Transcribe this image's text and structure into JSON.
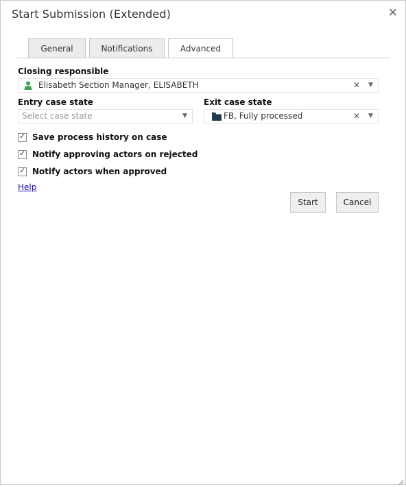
{
  "dialog": {
    "title": "Start Submission (Extended)",
    "close_icon": "close-icon"
  },
  "tabs": [
    {
      "label": "General",
      "active": false
    },
    {
      "label": "Notifications",
      "active": false
    },
    {
      "label": "Advanced",
      "active": true
    }
  ],
  "closing_responsible": {
    "label": "Closing responsible",
    "value": "Elisabeth Section Manager, ELISABETH",
    "icon": "person-icon",
    "icon_color": "#3aa757"
  },
  "entry_case_state": {
    "label": "Entry case state",
    "placeholder": "Select case state"
  },
  "exit_case_state": {
    "label": "Exit case state",
    "value": "FB, Fully processed",
    "icon": "folder-icon",
    "icon_color": "#1f3b4d"
  },
  "options": [
    {
      "label": "Save process history on case",
      "checked": true
    },
    {
      "label": "Notify approving actors on rejected",
      "checked": true
    },
    {
      "label": "Notify actors when approved",
      "checked": true
    }
  ],
  "help_link": "Help",
  "buttons": {
    "start": "Start",
    "cancel": "Cancel"
  },
  "glyphs": {
    "close": "✕",
    "clear": "✕",
    "dropdown": "▼",
    "tick": "✓"
  }
}
